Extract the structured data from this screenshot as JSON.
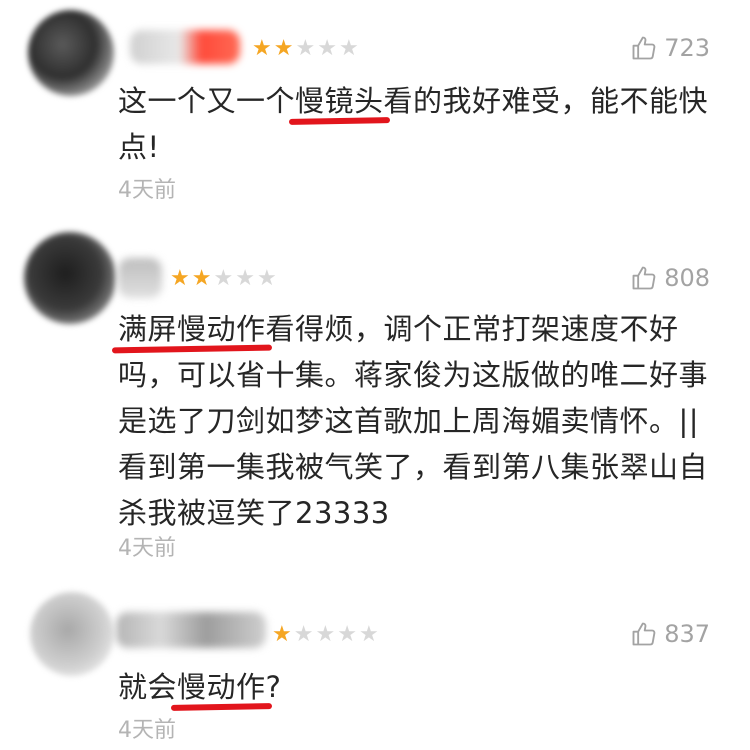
{
  "reviews": [
    {
      "rating": 2,
      "likes": "723",
      "content": {
        "a": "这一个又一个",
        "hl": "慢镜头",
        "b": "看的我好难受，能不能快点!"
      },
      "time": "4天前"
    },
    {
      "rating": 2,
      "likes": "808",
      "content": {
        "hl": "满屏慢动作",
        "b": "看得烦，调个正常打架速度不好吗，可以省十集。蒋家俊为这版做的唯二好事是选了刀剑如梦这首歌加上周海媚卖情怀。||看到第一集我被气笑了，看到第八集张翠山自杀我被逗笑了23333"
      },
      "time": "4天前"
    },
    {
      "rating": 1,
      "likes": "837",
      "content": {
        "a": "就会",
        "hl": "慢动作",
        "b": "?"
      },
      "time": "4天前"
    }
  ],
  "colors": {
    "star_on": "#f5a623",
    "star_off": "#d8d8d8",
    "highlight_underline": "#e2151c",
    "meta_text": "#a3a3a3"
  },
  "icons": {
    "like": "thumbs-up-outline-icon",
    "star": "star-icon"
  }
}
